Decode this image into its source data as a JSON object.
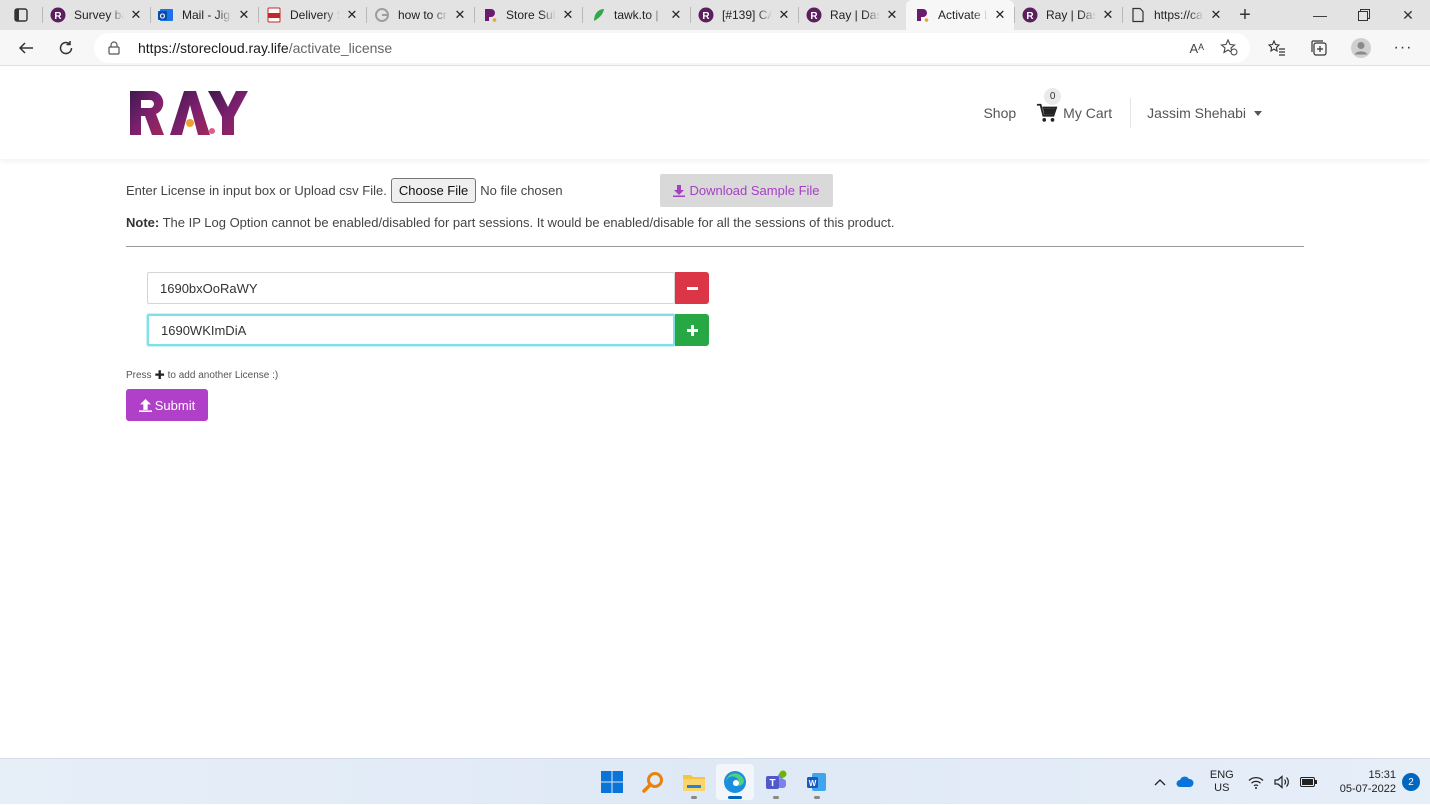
{
  "browser": {
    "tabs": [
      {
        "title": "Survey ba",
        "icon": "ray-icon"
      },
      {
        "title": "Mail - Jig",
        "icon": "outlook-icon"
      },
      {
        "title": "Delivery S",
        "icon": "pdf-icon"
      },
      {
        "title": "how to cr",
        "icon": "google-icon"
      },
      {
        "title": "Store Sub",
        "icon": "ray-r-icon"
      },
      {
        "title": "tawk.to |",
        "icon": "tawk-icon"
      },
      {
        "title": "[#139] CA",
        "icon": "ray-icon"
      },
      {
        "title": "Ray | Das",
        "icon": "ray-icon"
      },
      {
        "title": "Activate L",
        "icon": "ray-r-icon",
        "active": true
      },
      {
        "title": "Ray | Das",
        "icon": "ray-icon"
      },
      {
        "title": "https://ca",
        "icon": "page-icon"
      }
    ],
    "url_host": "https://storecloud.ray.life",
    "url_path": "/activate_license",
    "read_aloud_label": "Aᴬ"
  },
  "header": {
    "shop_label": "Shop",
    "cart_count": "0",
    "cart_label": "My Cart",
    "user_name": "Jassim Shehabi"
  },
  "form": {
    "upload_prompt": "Enter License in input box or Upload csv File.",
    "choose_file_label": "Choose File",
    "no_file_label": "No file chosen",
    "download_label": "Download Sample File",
    "note_label": "Note:",
    "note_text": " The IP Log Option cannot be enabled/disabled for part sessions. It would be enabled/disable for all the sessions of this product.",
    "licenses": [
      "1690bxOoRaWY",
      "1690WKImDiA"
    ],
    "hint_prefix": "Press",
    "hint_suffix": "to add another License :)",
    "submit_label": "Submit"
  },
  "taskbar": {
    "apps": [
      "windows-start-icon",
      "search-icon",
      "file-explorer-icon",
      "edge-icon",
      "teams-icon",
      "word-icon"
    ],
    "lang_top": "ENG",
    "lang_bottom": "US",
    "time": "15:31",
    "date": "05-07-2022",
    "notifications": "2"
  },
  "colors": {
    "brand_purple": "#b040c8",
    "remove_red": "#dc3545",
    "add_green": "#28a745",
    "focus_cyan": "#7fe0e6"
  }
}
